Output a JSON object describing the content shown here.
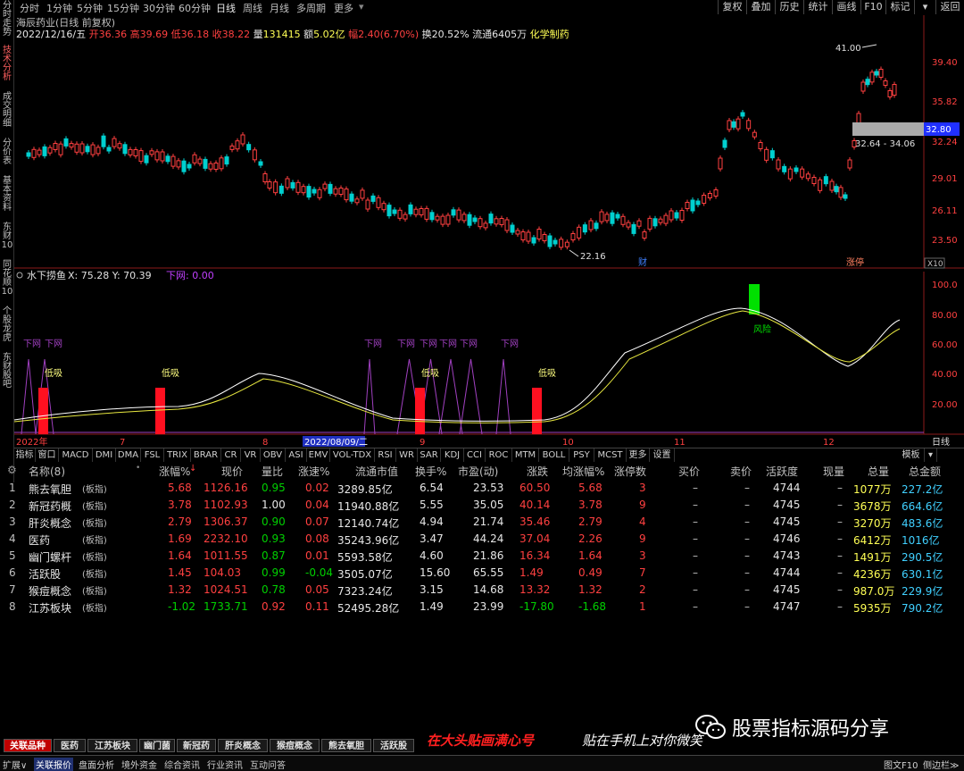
{
  "left_nav": [
    "分时走势",
    "技术分析",
    "成交明细",
    "分价表",
    "基本资料",
    "东财10",
    "同花顺10",
    "个股龙虎",
    "东财股吧"
  ],
  "periods": [
    "分时",
    "1分钟",
    "5分钟",
    "15分钟",
    "30分钟",
    "60分钟",
    "日线",
    "周线",
    "月线",
    "多周期",
    "更多"
  ],
  "active_period": "日线",
  "right_buttons": [
    "复权",
    "叠加",
    "历史",
    "统计",
    "画线",
    "F10",
    "标记",
    "返回"
  ],
  "stock": {
    "title": "海辰药业(日线 前复权)",
    "date": "2022/12/16/五",
    "open_label": "开",
    "open": "36.36",
    "high_label": "高",
    "high": "39.69",
    "low_label": "低",
    "low": "36.18",
    "close_label": "收",
    "close": "38.22",
    "volume_label": "量",
    "volume": "131415",
    "amount_label": "额",
    "amount": "5.02亿",
    "change_label": "幅",
    "change": "2.40(6.70%)",
    "turnover_label": "换",
    "turnover": "20.52%",
    "float_label": "流通",
    "float": "6405万",
    "industry": "化学制药"
  },
  "price_axis": [
    "39.40",
    "35.82",
    "32.24",
    "29.01",
    "26.11",
    "23.50"
  ],
  "price_tag": "32.80",
  "range_label": "32.64 - 34.06",
  "high_mark": "41.00",
  "low_mark": "22.16",
  "event_mark_1": "财",
  "event_mark_2": "涨停",
  "x10": "X10",
  "indicator": {
    "name": "水下捞鱼",
    "coords": "X: 75.28  Y: 70.39",
    "param": "下网: 0.00",
    "axis": [
      "100.0",
      "80.00",
      "60.00",
      "40.00",
      "20.00"
    ],
    "buy_label": "低吸",
    "net_label": "下网",
    "risk_label": "风险"
  },
  "date_axis": [
    "2022年",
    "7",
    "8",
    "9",
    "10",
    "11",
    "12"
  ],
  "date_highlight": "2022/08/09/二",
  "date_right": "日线",
  "indicator_tabs": [
    "指标",
    "窗口",
    "MACD",
    "DMI",
    "DMA",
    "FSL",
    "TRIX",
    "BRAR",
    "CR",
    "VR",
    "OBV",
    "ASI",
    "EMV",
    "VOL-TDX",
    "RSI",
    "WR",
    "SAR",
    "KDJ",
    "CCI",
    "ROC",
    "MTM",
    "BOLL",
    "PSY",
    "MCST",
    "更多",
    "设置"
  ],
  "template_btn": "模板",
  "table": {
    "headers": [
      "名称(8)",
      "涨幅%",
      "现价",
      "量比",
      "涨速%",
      "流通市值",
      "换手%",
      "市盈(动)",
      "涨跌",
      "均涨幅%",
      "涨停数",
      "买价",
      "卖价",
      "活跃度",
      "现量",
      "总量",
      "总金额"
    ],
    "rows": [
      {
        "idx": "1",
        "name": "熊去氧胆",
        "tag": "(板指)",
        "pct": "5.68",
        "price": "1126.16",
        "vr": "0.95",
        "spd": "0.02",
        "mcap": "3289.85亿",
        "turn": "6.54",
        "pe": "23.53",
        "chg": "60.50",
        "avg": "5.68",
        "lim": "3",
        "bid": "–",
        "ask": "–",
        "act": "4744",
        "now": "–",
        "vol": "1077万",
        "amt": "227.2亿"
      },
      {
        "idx": "2",
        "name": "新冠药概",
        "tag": "(板指)",
        "pct": "3.78",
        "price": "1102.93",
        "vr": "1.00",
        "spd": "0.04",
        "mcap": "11940.88亿",
        "turn": "5.55",
        "pe": "35.05",
        "chg": "40.14",
        "avg": "3.78",
        "lim": "9",
        "bid": "–",
        "ask": "–",
        "act": "4745",
        "now": "–",
        "vol": "3678万",
        "amt": "664.6亿"
      },
      {
        "idx": "3",
        "name": "肝炎概念",
        "tag": "(板指)",
        "pct": "2.79",
        "price": "1306.37",
        "vr": "0.90",
        "spd": "0.07",
        "mcap": "12140.74亿",
        "turn": "4.94",
        "pe": "21.74",
        "chg": "35.46",
        "avg": "2.79",
        "lim": "4",
        "bid": "–",
        "ask": "–",
        "act": "4745",
        "now": "–",
        "vol": "3270万",
        "amt": "483.6亿"
      },
      {
        "idx": "4",
        "name": "医药",
        "tag": "(板指)",
        "pct": "1.69",
        "price": "2232.10",
        "vr": "0.93",
        "spd": "0.08",
        "mcap": "35243.96亿",
        "turn": "3.47",
        "pe": "44.24",
        "chg": "37.04",
        "avg": "2.26",
        "lim": "9",
        "bid": "–",
        "ask": "–",
        "act": "4746",
        "now": "–",
        "vol": "6412万",
        "amt": "1016亿"
      },
      {
        "idx": "5",
        "name": "幽门螺杆",
        "tag": "(板指)",
        "pct": "1.64",
        "price": "1011.55",
        "vr": "0.87",
        "spd": "0.01",
        "mcap": "5593.58亿",
        "turn": "4.60",
        "pe": "21.86",
        "chg": "16.34",
        "avg": "1.64",
        "lim": "3",
        "bid": "–",
        "ask": "–",
        "act": "4743",
        "now": "–",
        "vol": "1491万",
        "amt": "290.5亿"
      },
      {
        "idx": "6",
        "name": "活跃股",
        "tag": "(板指)",
        "pct": "1.45",
        "price": "104.03",
        "vr": "0.99",
        "spd": "-0.04",
        "mcap": "3505.07亿",
        "turn": "15.60",
        "pe": "65.55",
        "chg": "1.49",
        "avg": "0.49",
        "lim": "7",
        "bid": "–",
        "ask": "–",
        "act": "4744",
        "now": "–",
        "vol": "4236万",
        "amt": "630.1亿"
      },
      {
        "idx": "7",
        "name": "猴痘概念",
        "tag": "(板指)",
        "pct": "1.32",
        "price": "1024.51",
        "vr": "0.78",
        "spd": "0.05",
        "mcap": "7323.24亿",
        "turn": "3.15",
        "pe": "14.68",
        "chg": "13.32",
        "avg": "1.32",
        "lim": "2",
        "bid": "–",
        "ask": "–",
        "act": "4745",
        "now": "–",
        "vol": "987.0万",
        "amt": "229.9亿"
      },
      {
        "idx": "8",
        "name": "江苏板块",
        "tag": "(板指)",
        "pct": "-1.02",
        "price": "1733.71",
        "vr": "0.92",
        "spd": "0.11",
        "mcap": "52495.28亿",
        "turn": "1.49",
        "pe": "23.99",
        "chg": "-17.80",
        "avg": "-1.68",
        "lim": "1",
        "bid": "–",
        "ask": "–",
        "act": "4747",
        "now": "–",
        "vol": "5935万",
        "amt": "790.2亿"
      }
    ]
  },
  "sheet_tabs": [
    "关联品种",
    "医药",
    "江苏板块",
    "幽门菌",
    "新冠药",
    "肝炎概念",
    "猴痘概念",
    "熊去氧胆",
    "活跃股"
  ],
  "bottom_bar": [
    "扩展∨",
    "关联报价",
    "盘面分析",
    "境外资金",
    "综合资讯",
    "行业资讯",
    "互动问答"
  ],
  "bottom_right": [
    "图文F10",
    "侧边栏≫"
  ],
  "banner_red": "在大头贴画满心号",
  "banner_white": "贴在手机上对你微笑",
  "watermark": "股票指标源码分享",
  "colors": {
    "up": "#ff4040",
    "down": "#00d0d0",
    "highlight": "#ffff55",
    "down_text": "#00d000",
    "risk": "#00e000",
    "net": "#a040c0"
  }
}
